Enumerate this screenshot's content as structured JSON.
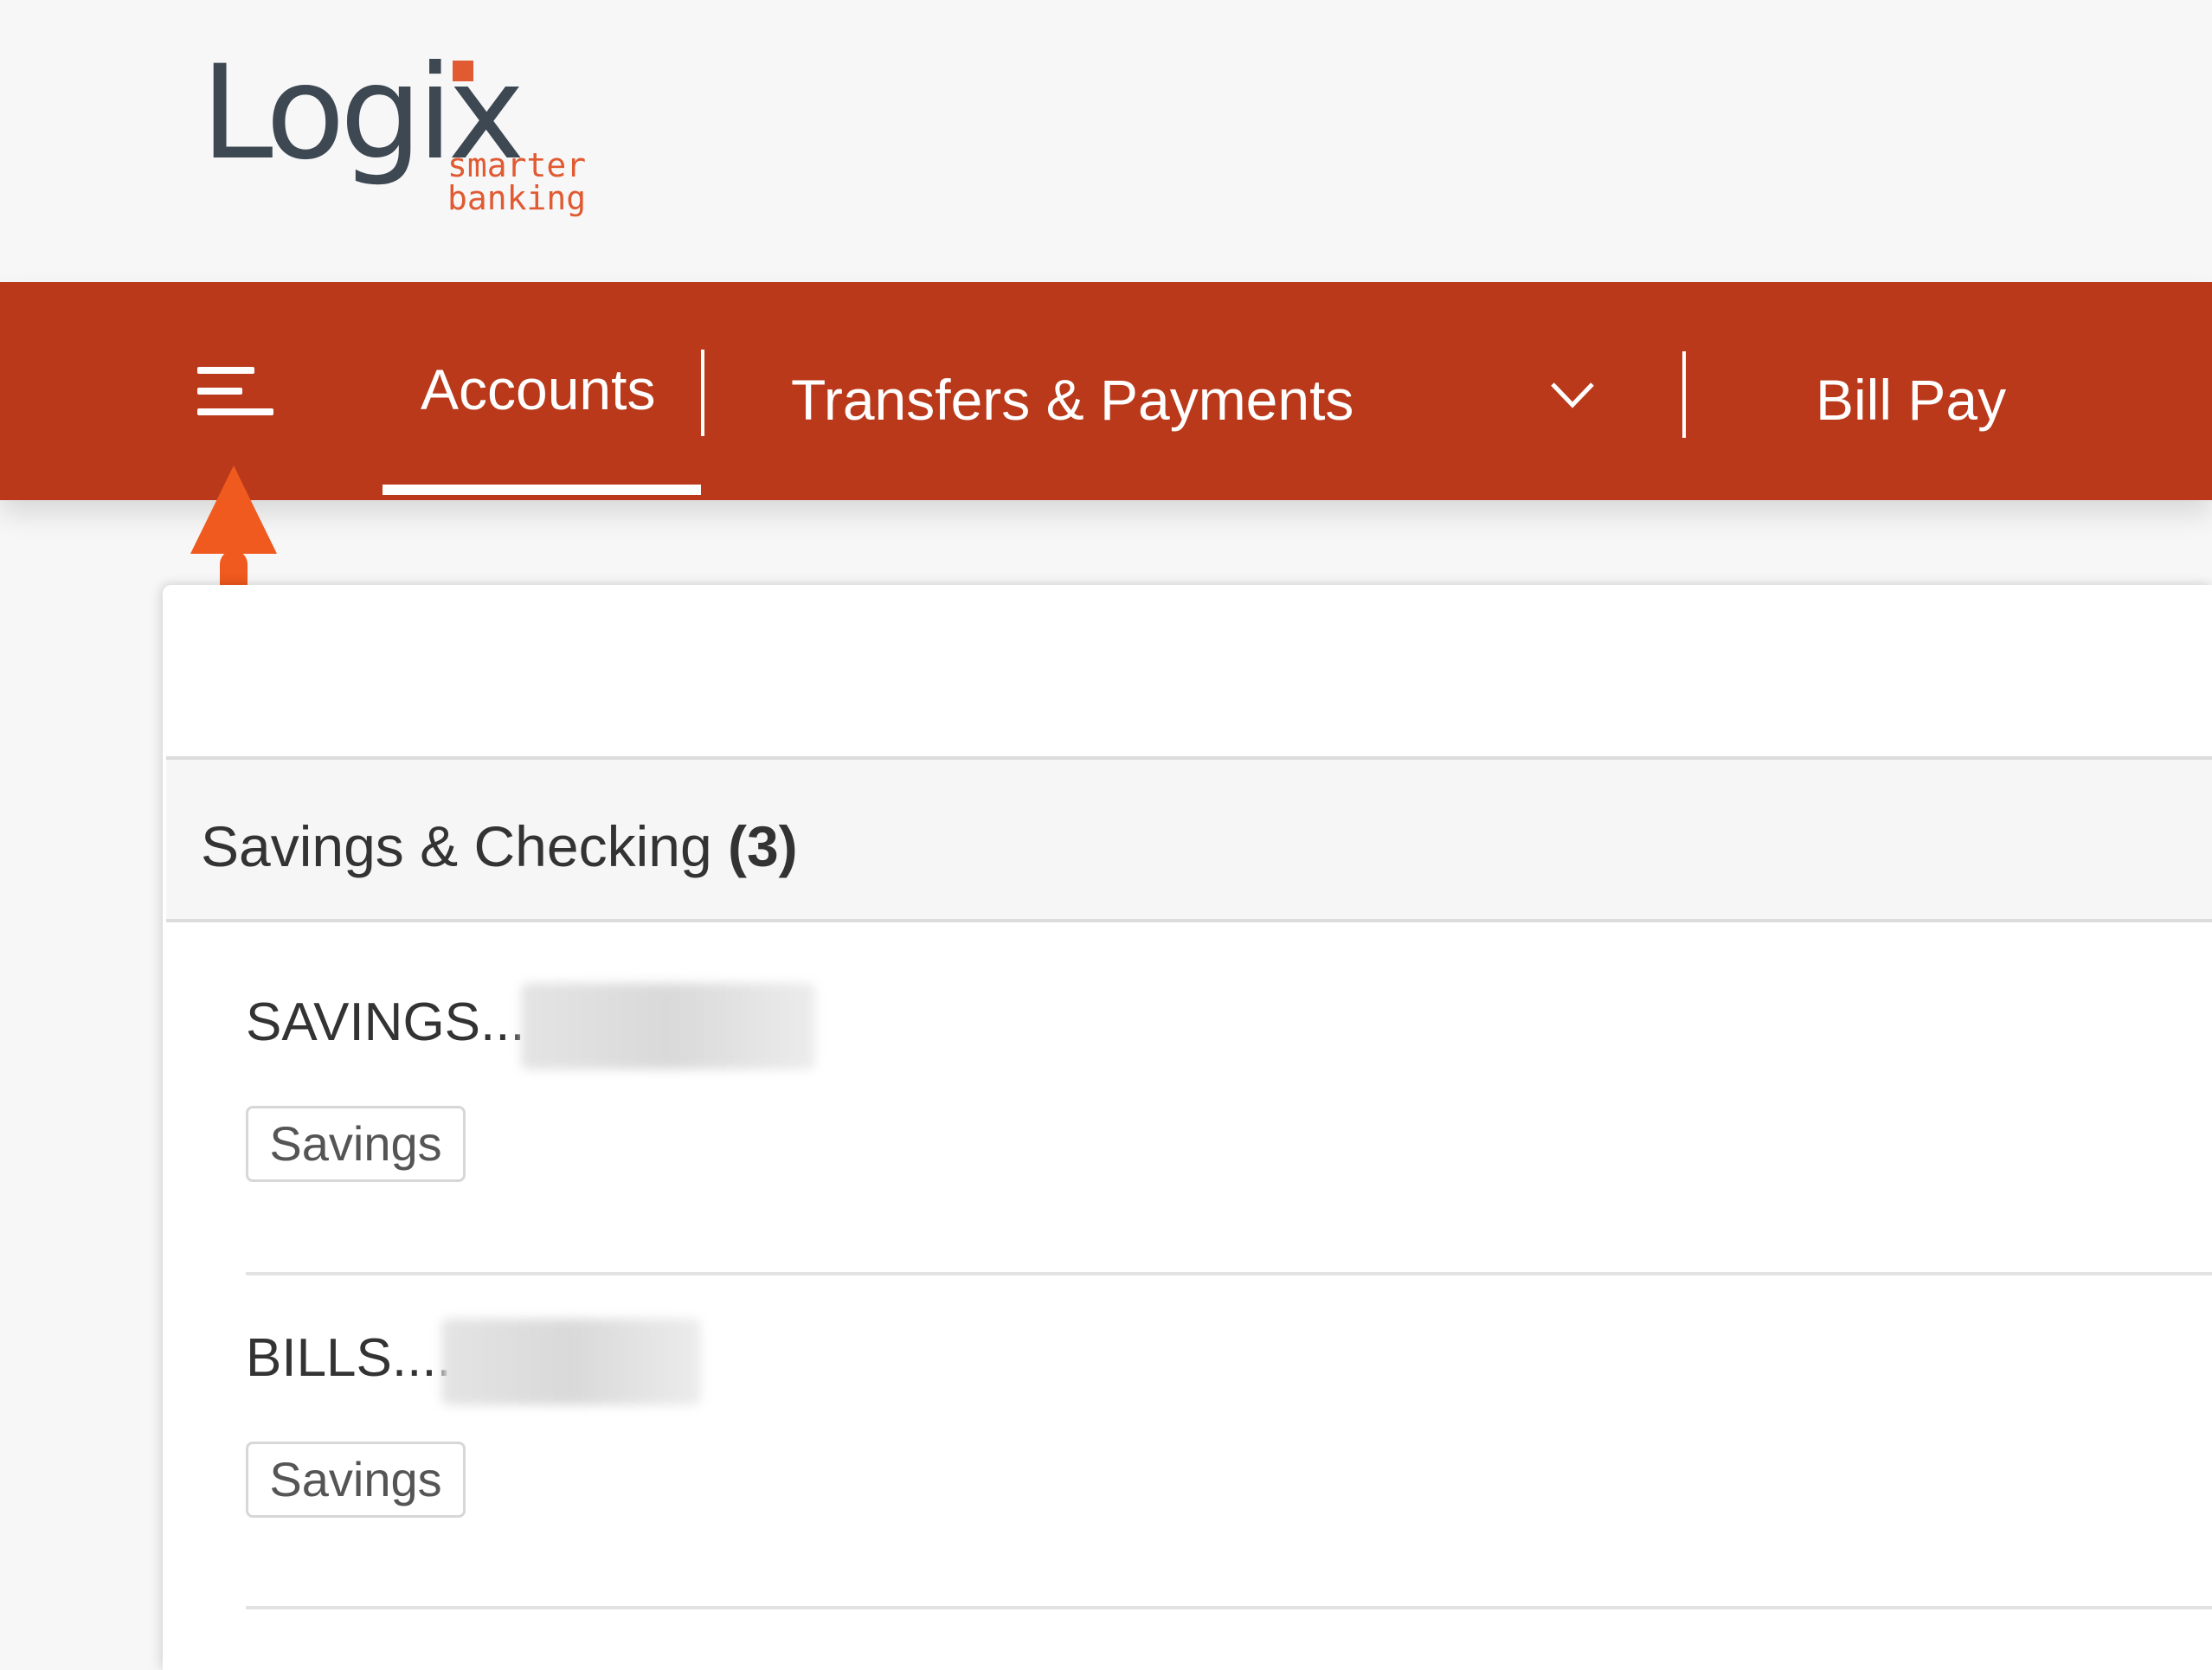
{
  "brand": {
    "logo_word": "Logix",
    "tagline_line1": "smarter",
    "tagline_line2": "banking",
    "accent_color": "#b9391a",
    "tagline_color": "#e05a32"
  },
  "nav": {
    "menu_icon": "hamburger-menu-icon",
    "items": [
      {
        "label": "Accounts",
        "active": true
      },
      {
        "label": "Transfers & Payments",
        "has_dropdown": true
      },
      {
        "label": "Bill Pay"
      }
    ]
  },
  "annotation": {
    "arrow_color": "#f05a1e",
    "arrow_icon": "up-arrow-icon"
  },
  "accounts_section": {
    "title": "Savings & Checking",
    "count": "(3)",
    "accounts": [
      {
        "name": "SAVINGS...",
        "type": "Savings"
      },
      {
        "name": "BILLS....",
        "type": "Savings"
      }
    ]
  }
}
